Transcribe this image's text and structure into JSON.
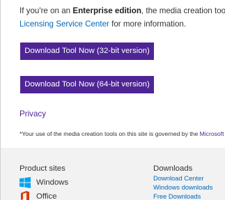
{
  "intro": {
    "line1_prefix": "If you're on an ",
    "line1_bold": "Enterprise edition",
    "line1_suffix": ", the media creation tool won't w",
    "line2_link": "Licensing Service Center",
    "line2_suffix": " for more information."
  },
  "buttons": {
    "download_32": "Download Tool Now (32-bit version)",
    "download_64": "Download Tool Now (64-bit version)"
  },
  "privacy_link": "Privacy",
  "disclaimer": {
    "text": "*Your use of the media creation tools on this site is governed by the ",
    "link": "Microsoft Ter"
  },
  "footer": {
    "product_sites_title": "Product sites",
    "products": [
      {
        "label": "Windows",
        "icon": "windows-logo-icon"
      },
      {
        "label": "Office",
        "icon": "office-logo-icon"
      }
    ],
    "downloads_title": "Downloads",
    "downloads": [
      "Download Center",
      "Windows downloads",
      "Free Downloads"
    ]
  },
  "colors": {
    "button_purple": "#4e2595",
    "link_blue": "#0067b8",
    "footer_bg": "#f2f2f2",
    "windows_blue": "#00a4ef",
    "office_red": "#d83b01"
  }
}
